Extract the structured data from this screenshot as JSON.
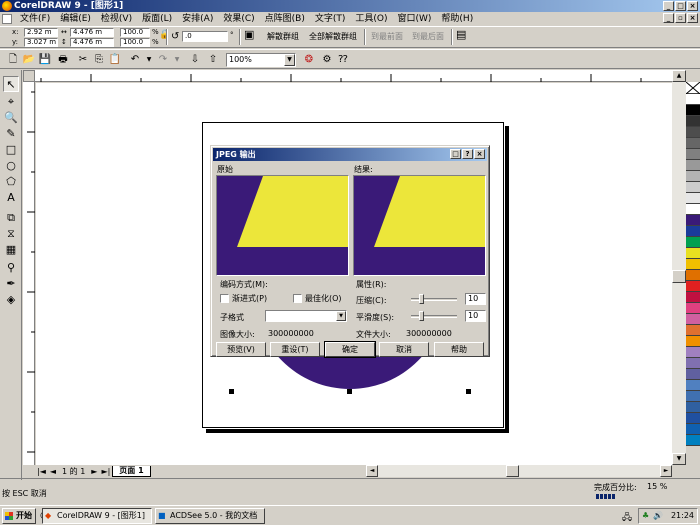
{
  "window": {
    "title": "CorelDRAW 9 - [图形1]"
  },
  "menu": [
    "文件(F)",
    "编辑(E)",
    "检视(V)",
    "版面(L)",
    "安排(A)",
    "效果(C)",
    "点阵图(B)",
    "文字(T)",
    "工具(O)",
    "窗口(W)",
    "帮助(H)"
  ],
  "propbar": {
    "x_label": "x:",
    "x_value": "2.92 m",
    "y_label": "y:",
    "y_value": "3.027 m",
    "w_value": "4.476 m",
    "h_value": "4.476 m",
    "scale_x": "100.0",
    "scale_y": "100.0",
    "pct": "%",
    "rotation": ".0",
    "degree": "°",
    "ungroup": "解散群组",
    "ungroup_all": "全部解散群组",
    "to_front": "到最前面",
    "to_back": "到最后面"
  },
  "stdbar": {
    "zoom": "100%"
  },
  "pagebar": {
    "page_of": "1 的 1",
    "page_tab": "页面 1"
  },
  "status": {
    "hint": "按 ESC 取消",
    "progress_label": "完成百分比:",
    "progress_value": "15 %"
  },
  "dialog": {
    "title": "JPEG 输出",
    "original_label": "原始",
    "result_label": "结果:",
    "encoding_label": "编码方式(M):",
    "progressive_label": "渐进式(P)",
    "optimize_label": "最佳化(O)",
    "subformat_label": "子格式",
    "image_size_label": "图像大小:",
    "image_size_value": "300000000",
    "properties_label": "属性(R):",
    "compress_label": "压缩(C):",
    "compress_value": "10",
    "smooth_label": "平滑度(S):",
    "smooth_value": "10",
    "file_size_label": "文件大小:",
    "file_size_value": "300000000",
    "buttons": {
      "preview": "预览(V)",
      "reset": "重设(T)",
      "ok": "确定",
      "cancel": "取消",
      "help": "帮助"
    },
    "slider_compress_level": 0.2,
    "slider_smooth_level": 0.2
  },
  "taskbar": {
    "start": "开始",
    "tasks": [
      "CorelDRAW 9 - [图形1]",
      "ACDSee 5.0 - 我的文档"
    ],
    "clock": "21:24"
  },
  "palette_colors": [
    "#ffffff",
    "#000000",
    "#333333",
    "#4d4d4d",
    "#666666",
    "#808080",
    "#999999",
    "#b3b3b3",
    "#cccccc",
    "#e6e6e6",
    "#ffffff",
    "#3a1a78",
    "#1a3c9a",
    "#00a050",
    "#e8e020",
    "#f0c000",
    "#e07000",
    "#e02020",
    "#c01040",
    "#e04080",
    "#d060a0",
    "#e07030",
    "#f09000",
    "#a080c0",
    "#8070b0",
    "#6060a0",
    "#5080c0",
    "#4070b0",
    "#3060a0",
    "#2050a0",
    "#1060b0",
    "#0080c0"
  ],
  "colors": {
    "purple": "#3a1a78",
    "yellow": "#ece63a",
    "title_blue": "#0a246a"
  }
}
